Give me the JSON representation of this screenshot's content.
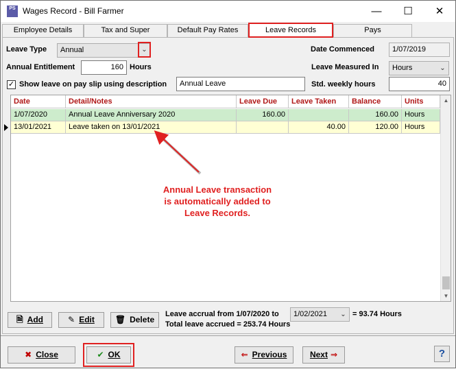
{
  "window": {
    "title": "Wages Record - Bill Farmer",
    "app_icon_text": "PS"
  },
  "tabs": [
    {
      "label": "Employee Details",
      "active": false
    },
    {
      "label": "Tax and Super",
      "active": false
    },
    {
      "label": "Default Pay Rates",
      "active": false
    },
    {
      "label": "Leave Records",
      "active": true
    },
    {
      "label": "Pays",
      "active": false
    }
  ],
  "form": {
    "leave_type_label": "Leave Type",
    "leave_type_value": "Annual",
    "date_commenced_label": "Date Commenced",
    "date_commenced_value": "1/07/2019",
    "annual_entitlement_label": "Annual Entitlement",
    "annual_entitlement_value": "160",
    "annual_entitlement_unit": "Hours",
    "leave_measured_label": "Leave Measured In",
    "leave_measured_value": "Hours",
    "show_leave_label": "Show leave on pay slip using description",
    "show_leave_checked": true,
    "show_leave_description": "Annual Leave",
    "std_weekly_label": "Std. weekly hours",
    "std_weekly_value": "40"
  },
  "grid": {
    "columns": [
      "Date",
      "Detail/Notes",
      "Leave Due",
      "Leave Taken",
      "Balance",
      "Units"
    ],
    "rows": [
      {
        "date": "1/07/2020",
        "detail": "Annual Leave Anniversary 2020",
        "due": "160.00",
        "taken": "",
        "balance": "160.00",
        "units": "Hours"
      },
      {
        "date": "13/01/2021",
        "detail": "Leave taken on 13/01/2021",
        "due": "",
        "taken": "40.00",
        "balance": "120.00",
        "units": "Hours"
      }
    ]
  },
  "annotation": {
    "text": "Annual Leave transaction is automatically added to Leave Records.",
    "color": "#e02020"
  },
  "actions": {
    "add": "Add",
    "edit": "Edit",
    "delete": "Delete"
  },
  "accrual": {
    "label": "Leave accrual from 1/07/2020 to",
    "date": "1/02/2021",
    "result": "= 93.74 Hours",
    "total": "Total leave accrued = 253.74 Hours"
  },
  "footer": {
    "close": "Close",
    "ok": "OK",
    "previous": "Previous",
    "next": "Next",
    "help": "?"
  },
  "colors": {
    "highlight": "#e02020",
    "header_text": "#b01818",
    "row_green": "#cdeccc",
    "row_yellow": "#ffffd4"
  }
}
